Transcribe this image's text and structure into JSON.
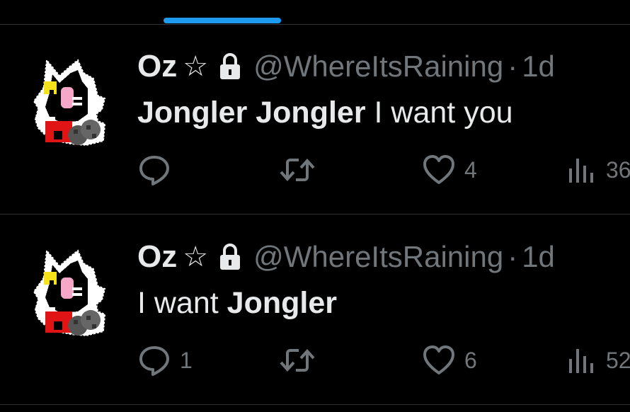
{
  "tweets": [
    {
      "author": {
        "name": "Oz",
        "handle": "@WhereItsRaining",
        "time": "1d"
      },
      "text": {
        "bold1": "Jongler Jongler",
        "rest1": " I want you",
        "pre2": "",
        "bold2": ""
      },
      "actions": {
        "replies": "",
        "retweets": "",
        "likes": "4",
        "views": "36"
      }
    },
    {
      "author": {
        "name": "Oz",
        "handle": "@WhereItsRaining",
        "time": "1d"
      },
      "text": {
        "pre": "I want ",
        "bold": "Jongler"
      },
      "actions": {
        "replies": "1",
        "retweets": "",
        "likes": "6",
        "views": "52"
      }
    }
  ],
  "icons": {
    "verified": "star-outline-icon",
    "protected": "lock-icon",
    "reply": "speech-bubble-icon",
    "retweet": "retweet-icon",
    "like": "heart-icon",
    "views": "bar-chart-icon"
  },
  "colors": {
    "background": "#000000",
    "text": "#e7e9ea",
    "muted": "#71767b",
    "accent": "#1d9bf0"
  }
}
